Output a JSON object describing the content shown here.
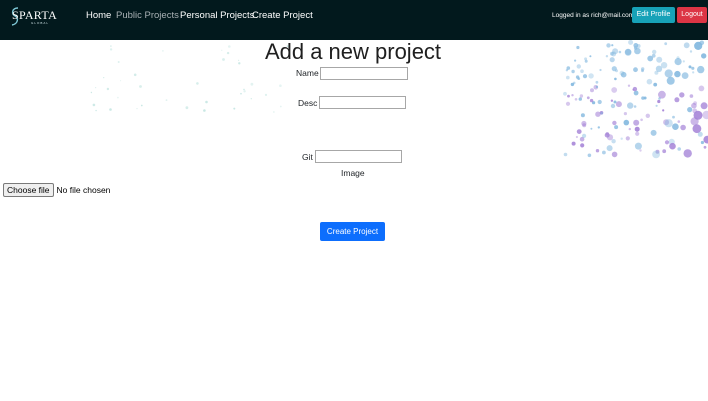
{
  "navbar": {
    "logo": {
      "wordmark": "SPARTA",
      "subtext": "GLOBAL"
    },
    "links": [
      {
        "label": "Home"
      },
      {
        "label": "Public Projects"
      },
      {
        "label": "Personal Projects"
      },
      {
        "label": "Create Project"
      }
    ],
    "login_status": "Logged in as rich@mail.com",
    "edit_profile_label": "Edit Profile",
    "logout_label": "Logout"
  },
  "form": {
    "title": "Add a new project",
    "name_label": "Name",
    "name_value": "",
    "desc_label": "Desc",
    "desc_value": "",
    "git_label": "Git",
    "git_value": "",
    "image_label": "Image",
    "file_button_label": "Choose file",
    "file_status": "No file chosen",
    "submit_label": "Create Project"
  },
  "colors": {
    "navbar_bg": "#02191d",
    "edit_profile": "#17a2b8",
    "logout": "#dc3545",
    "create_button": "#0d6efd",
    "decor_blue": "#7fb6de",
    "decor_purple": "#a27fd6"
  }
}
